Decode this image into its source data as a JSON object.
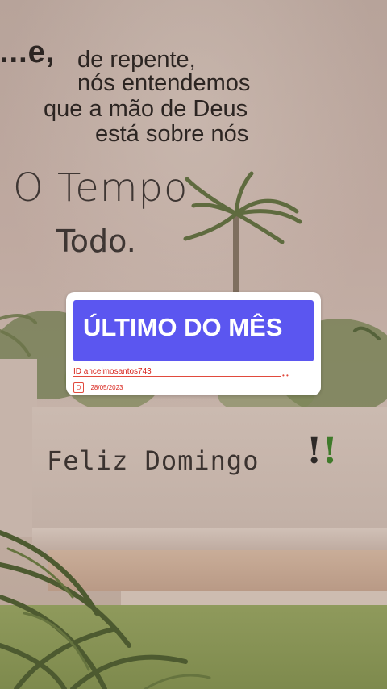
{
  "quote": {
    "line_e": "...e,",
    "line1": "de repente,",
    "line2": "nós entendemos",
    "line3": "que a mão de Deus",
    "line4": "está sobre nós",
    "tempo": "O Tempo",
    "todo": "Todo."
  },
  "greeting": {
    "text": "Feliz Domingo",
    "exclaim": "!!",
    "exclaim_colors": [
      "#2e2a28",
      "#3f7a2a"
    ]
  },
  "card": {
    "title": "ÚLTIMO DO MÊS",
    "id_text": "ID  ancelmosantos743",
    "icon_letter": "D",
    "date": "28/05/2023",
    "banner_color": "#5b56f0",
    "accent_color": "#d8241c"
  }
}
